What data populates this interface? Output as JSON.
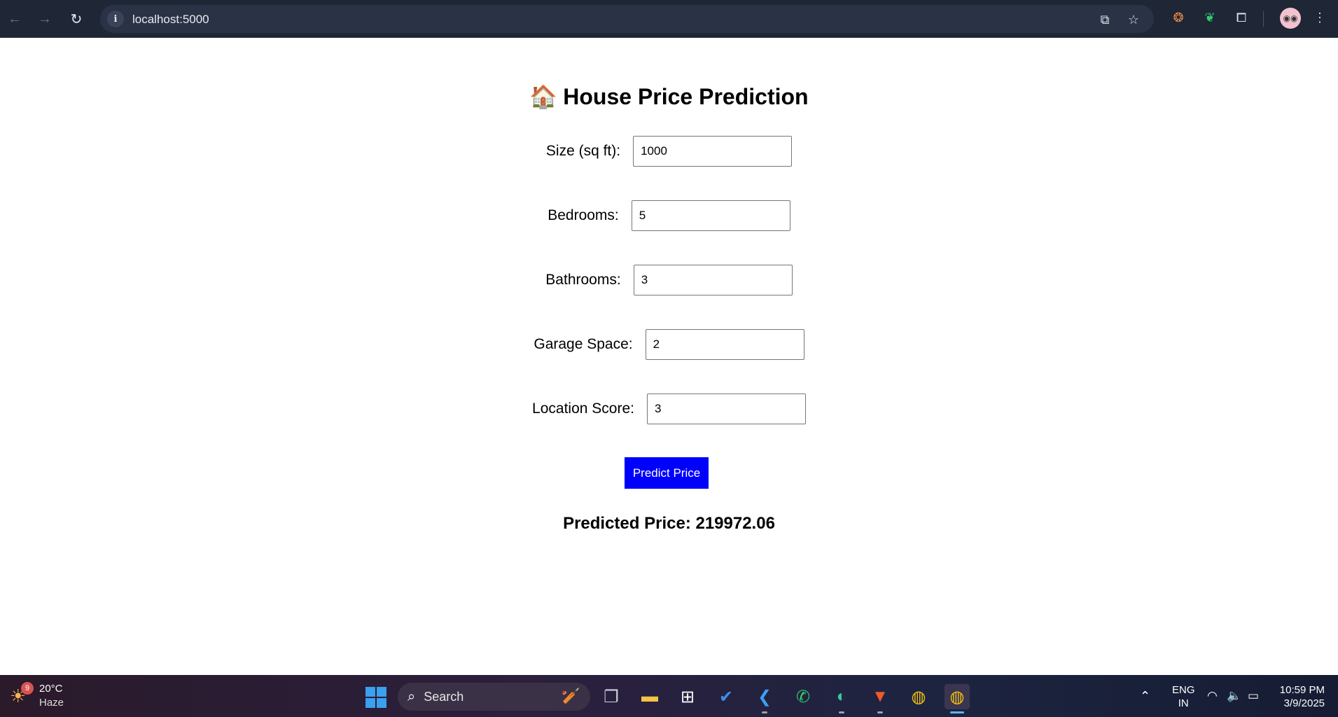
{
  "browser": {
    "url": "localhost:5000",
    "back_icon": "arrow-left",
    "forward_icon": "arrow-right",
    "reload_icon": "reload",
    "info_icon": "info",
    "translate_icon": "translate",
    "bookmark_icon": "star",
    "extensions": [
      "cookie-extension",
      "leaf-extension",
      "puzzle-extension"
    ],
    "profile_icon": "avatar"
  },
  "page": {
    "title": "House Price Prediction",
    "title_icon": "🏠",
    "fields": [
      {
        "label": "Size (sq ft):",
        "value": "1000"
      },
      {
        "label": "Bedrooms:",
        "value": "5"
      },
      {
        "label": "Bathrooms:",
        "value": "3"
      },
      {
        "label": "Garage Space:",
        "value": "2"
      },
      {
        "label": "Location Score:",
        "value": "3"
      }
    ],
    "predict_button": "Predict Price",
    "result": "Predicted Price: 219972.06",
    "accent_color": "#0000ff"
  },
  "taskbar": {
    "weather": {
      "badge": "9",
      "temp": "20°C",
      "condition": "Haze"
    },
    "search_label": "Search",
    "apps": [
      "task-view",
      "file-explorer",
      "microsoft-store",
      "todo",
      "vscode",
      "whatsapp",
      "edge",
      "brave",
      "chrome",
      "chrome-active"
    ],
    "language": {
      "line1": "ENG",
      "line2": "IN"
    },
    "clock": {
      "time": "10:59 PM",
      "date": "3/9/2025"
    }
  }
}
